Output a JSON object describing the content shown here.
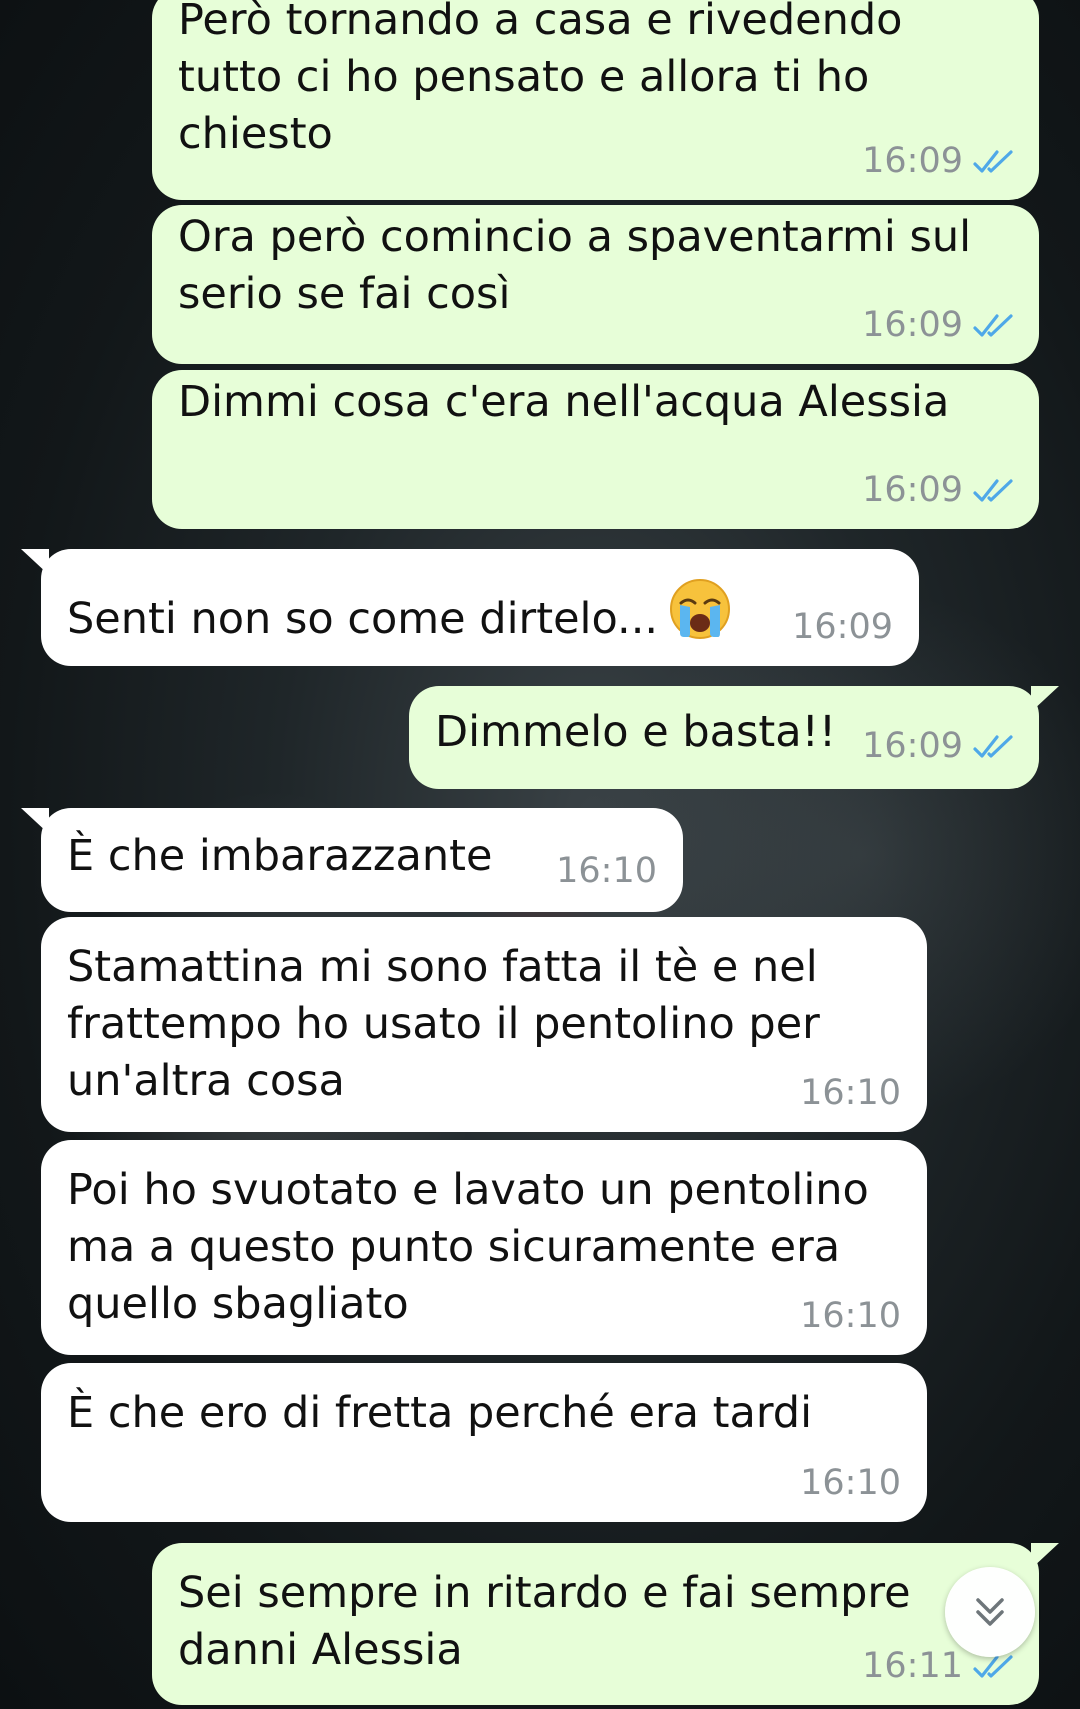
{
  "messages": [
    {
      "direction": "out",
      "text": "Però tornando a casa e rivedendo\ntutto ci ho pensato e allora ti ho\nchiesto",
      "time": "16:09",
      "status": "read"
    },
    {
      "direction": "out",
      "text": "Ora però comincio a spaventarmi sul\nserio se fai così",
      "time": "16:09",
      "status": "read"
    },
    {
      "direction": "out",
      "text": "Dimmi cosa c'era nell'acqua Alessia",
      "time": "16:09",
      "status": "read"
    },
    {
      "direction": "in",
      "text": "Senti non so come dirtelo...",
      "emoji": "loudly-crying-face",
      "time": "16:09"
    },
    {
      "direction": "out",
      "text": "Dimmelo e basta!!",
      "time": "16:09",
      "status": "read"
    },
    {
      "direction": "in",
      "text": "È che imbarazzante",
      "time": "16:10"
    },
    {
      "direction": "in",
      "text": "Stamattina mi sono fatta il tè e nel\nfrattempo ho usato il pentolino per\nun'altra cosa",
      "time": "16:10"
    },
    {
      "direction": "in",
      "text": "Poi ho svuotato e lavato un pentolino\nma a questo punto sicuramente era\nquello sbagliato",
      "time": "16:10"
    },
    {
      "direction": "in",
      "text": "È che ero di fretta perché era tardi",
      "time": "16:10"
    },
    {
      "direction": "out",
      "text": "Sei sempre in ritardo e fai sempre\ndanni Alessia",
      "time": "16:11",
      "status": "read"
    }
  ],
  "colors": {
    "outgoing_bubble": "#e7fed8",
    "incoming_bubble": "#ffffff",
    "read_ticks": "#4fa8e8",
    "timestamp": "#8c9296"
  },
  "icons": {
    "read_ticks": "double-check-icon",
    "scroll_down": "chevron-double-down-icon"
  }
}
